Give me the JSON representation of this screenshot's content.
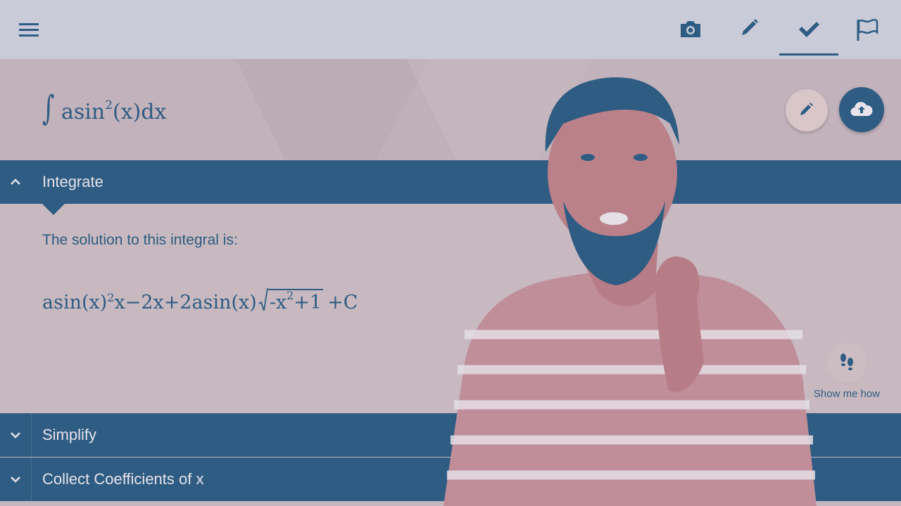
{
  "toolbar": {
    "icons": [
      "menu-icon",
      "camera-icon",
      "pencil-icon",
      "check-icon",
      "flag-icon"
    ],
    "active_tab": "check-icon"
  },
  "problem": {
    "integral_symbol": "∫",
    "func": "asin",
    "power": "2",
    "rest": "(x)dx"
  },
  "sections": {
    "integrate": {
      "label": "Integrate"
    },
    "simplify": {
      "label": "Simplify"
    },
    "collect": {
      "label": "Collect Coefficients of x"
    }
  },
  "solution": {
    "intro": "The solution to this integral is:",
    "part1": "asin(x)",
    "exp1": "2",
    "part2": "x−2x+2asin(x)",
    "radicand_a": "-x",
    "exp2": "2",
    "radicand_b": "+1",
    "part3": "+C"
  },
  "show_me_how": {
    "label": "Show me how"
  },
  "colors": {
    "accent": "#2e5c82",
    "toolbar_bg": "#c9cbd9",
    "content_bg": "#c8b9c0"
  }
}
